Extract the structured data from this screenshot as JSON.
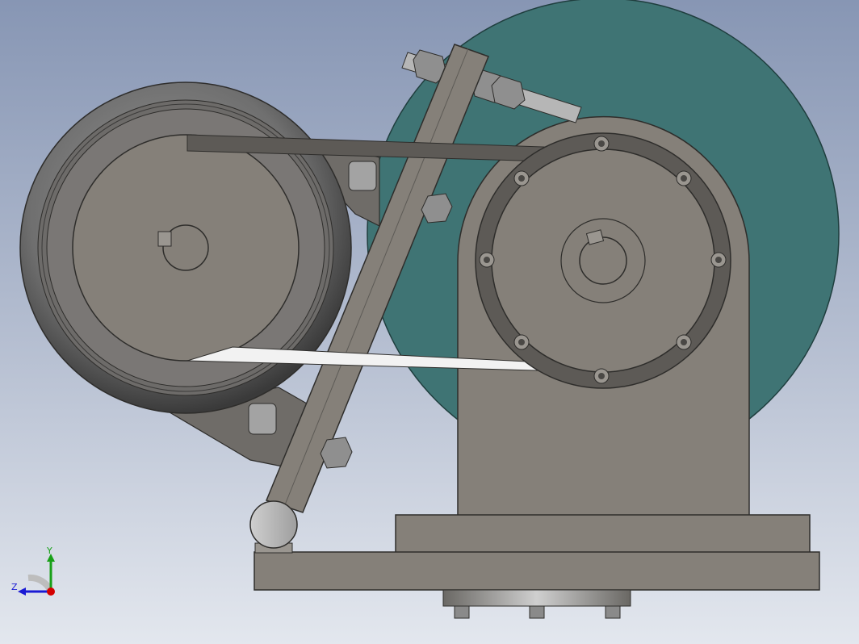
{
  "viewport": {
    "background_top": "#8796b4",
    "background_bottom": "#e3e7ee"
  },
  "model": {
    "part_color": "#858079",
    "part_dark": "#5d5a56",
    "disk_color": "#3f7474",
    "belt_color": "#f2f2f2"
  },
  "triad": {
    "x_color": "#d40000",
    "y_color": "#18a018",
    "z_color": "#1a1ad4",
    "y_label": "Y",
    "z_label": "Z"
  }
}
